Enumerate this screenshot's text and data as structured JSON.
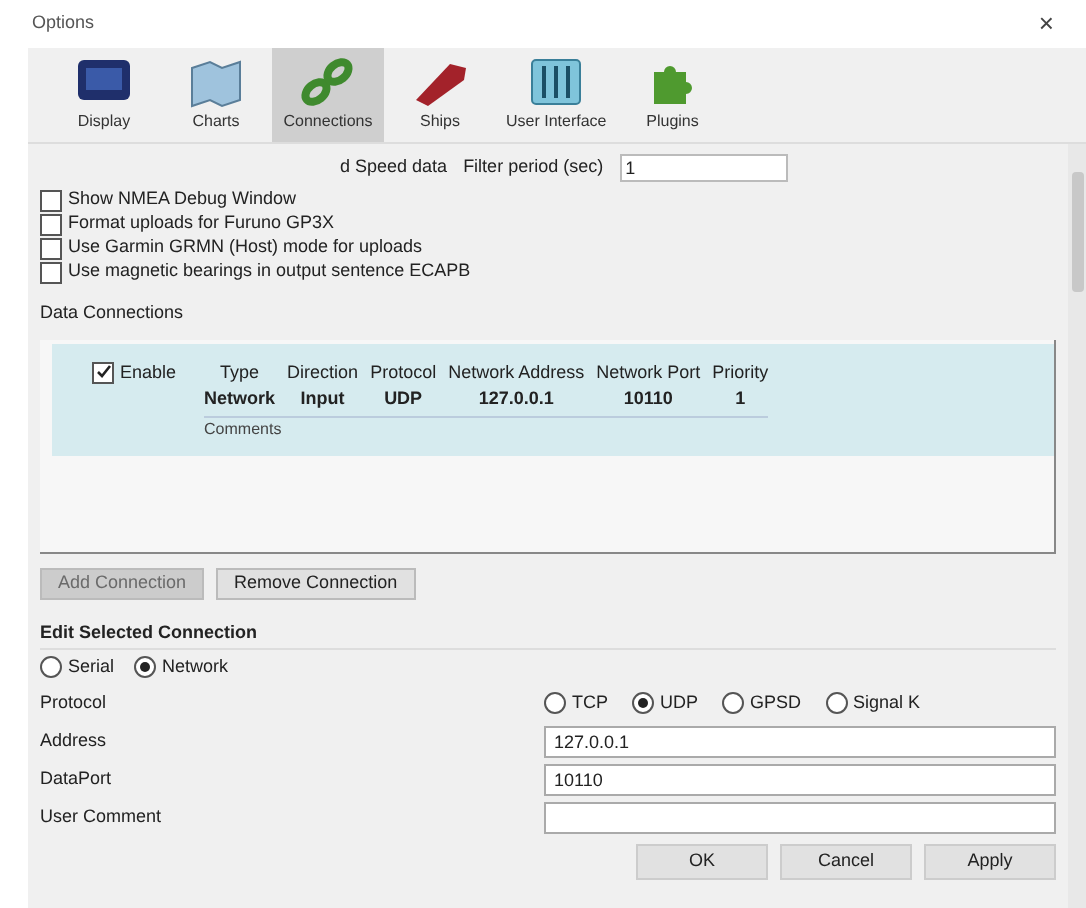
{
  "window": {
    "title": "Options",
    "close": "×"
  },
  "tabs": [
    {
      "label": "Display",
      "selected": false,
      "kind": "monitor"
    },
    {
      "label": "Charts",
      "selected": false,
      "kind": "charts"
    },
    {
      "label": "Connections",
      "selected": true,
      "kind": "chain"
    },
    {
      "label": "Ships",
      "selected": false,
      "kind": "ship"
    },
    {
      "label": "User Interface",
      "selected": false,
      "kind": "ui"
    },
    {
      "label": "Plugins",
      "selected": false,
      "kind": "puzzle"
    }
  ],
  "filter": {
    "label": "d Speed data",
    "period_label": "Filter period (sec)",
    "period_value": "1"
  },
  "options": [
    {
      "label": "Show NMEA Debug Window",
      "checked": false
    },
    {
      "label": "Format uploads for Furuno GP3X",
      "checked": false
    },
    {
      "label": "Use Garmin GRMN (Host) mode for uploads",
      "checked": false
    },
    {
      "label": "Use magnetic bearings in output sentence ECAPB",
      "checked": false
    }
  ],
  "data_connections": {
    "title": "Data Connections",
    "connection": {
      "enable_label": "Enable",
      "enabled": true,
      "selected": true,
      "columns": [
        {
          "heading": "Type",
          "value": "Network"
        },
        {
          "heading": "Direction",
          "value": "Input"
        },
        {
          "heading": "Protocol",
          "value": "UDP"
        },
        {
          "heading": "Network Address",
          "value": "127.0.0.1"
        },
        {
          "heading": "Network Port",
          "value": "10110"
        },
        {
          "heading": "Priority",
          "value": "1"
        }
      ],
      "comment_label": "Comments"
    }
  },
  "connection_buttons": [
    {
      "label": "Add Connection",
      "disabled": true
    },
    {
      "label": "Remove Connection",
      "disabled": false
    }
  ],
  "edit": {
    "title": "Edit Selected Connection",
    "source": [
      {
        "label": "Serial",
        "selected": false
      },
      {
        "label": "Network",
        "selected": true
      }
    ],
    "protocol_label": "Protocol",
    "protocols": [
      {
        "label": "TCP",
        "selected": false
      },
      {
        "label": "UDP",
        "selected": true
      },
      {
        "label": "GPSD",
        "selected": false
      },
      {
        "label": "Signal K",
        "selected": false
      }
    ],
    "fields": [
      {
        "label": "Address",
        "value": "127.0.0.1"
      },
      {
        "label": "DataPort",
        "value": "10110"
      },
      {
        "label": "User Comment"
      }
    ]
  },
  "footer_buttons": [
    "OK",
    "Cancel",
    "Apply"
  ]
}
